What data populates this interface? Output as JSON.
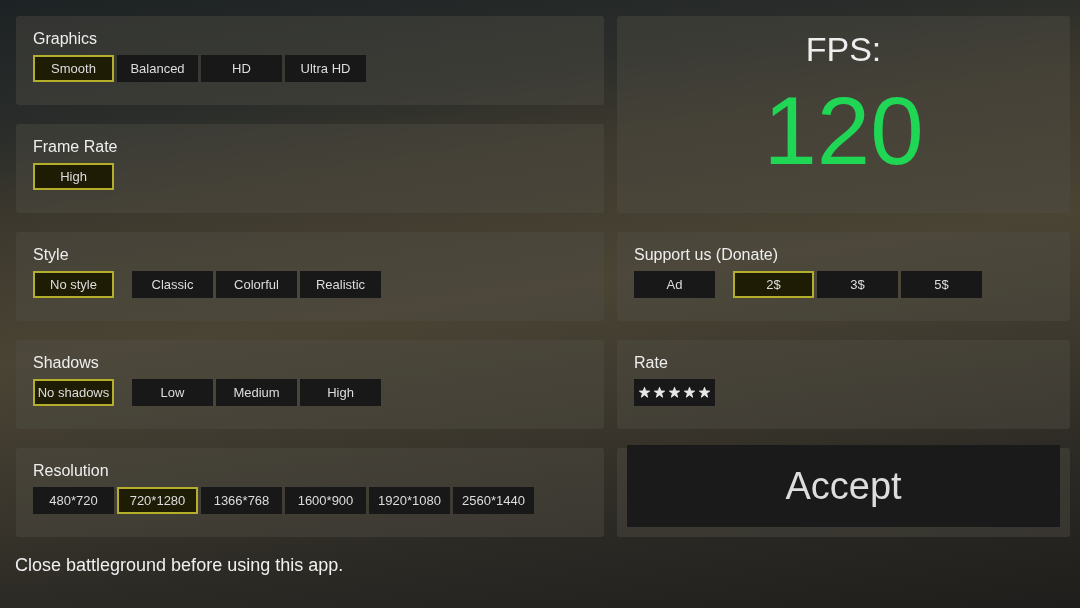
{
  "settings": [
    {
      "title": "Graphics",
      "option_groups": [
        [
          {
            "label": "Smooth",
            "selected": true
          },
          {
            "label": "Balanced",
            "selected": false
          },
          {
            "label": "HD",
            "selected": false
          },
          {
            "label": "Ultra HD",
            "selected": false
          }
        ]
      ]
    },
    {
      "title": "Frame Rate",
      "option_groups": [
        [
          {
            "label": "High",
            "selected": true
          }
        ]
      ]
    },
    {
      "title": "Style",
      "option_groups": [
        [
          {
            "label": "No style",
            "selected": true
          }
        ],
        [
          {
            "label": "Classic",
            "selected": false
          },
          {
            "label": "Colorful",
            "selected": false
          },
          {
            "label": "Realistic",
            "selected": false
          }
        ]
      ]
    },
    {
      "title": "Shadows",
      "option_groups": [
        [
          {
            "label": "No shadows",
            "selected": true
          }
        ],
        [
          {
            "label": "Low",
            "selected": false
          },
          {
            "label": "Medium",
            "selected": false
          },
          {
            "label": "High",
            "selected": false
          }
        ]
      ]
    },
    {
      "title": "Resolution",
      "option_groups": [
        [
          {
            "label": "480*720",
            "selected": false
          },
          {
            "label": "720*1280",
            "selected": true
          },
          {
            "label": "1366*768",
            "selected": false
          },
          {
            "label": "1600*900",
            "selected": false
          },
          {
            "label": "1920*1080",
            "selected": false
          },
          {
            "label": "2560*1440",
            "selected": false
          }
        ]
      ]
    }
  ],
  "fps": {
    "label": "FPS:",
    "value": "120"
  },
  "support": {
    "title": "Support us (Donate)",
    "option_groups": [
      [
        {
          "label": "Ad",
          "selected": false
        }
      ],
      [
        {
          "label": "2$",
          "selected": true
        },
        {
          "label": "3$",
          "selected": false
        },
        {
          "label": "5$",
          "selected": false
        }
      ]
    ]
  },
  "rate": {
    "title": "Rate",
    "stars": 5
  },
  "accept_button": "Accept",
  "footer_note": "Close battleground before using this app."
}
